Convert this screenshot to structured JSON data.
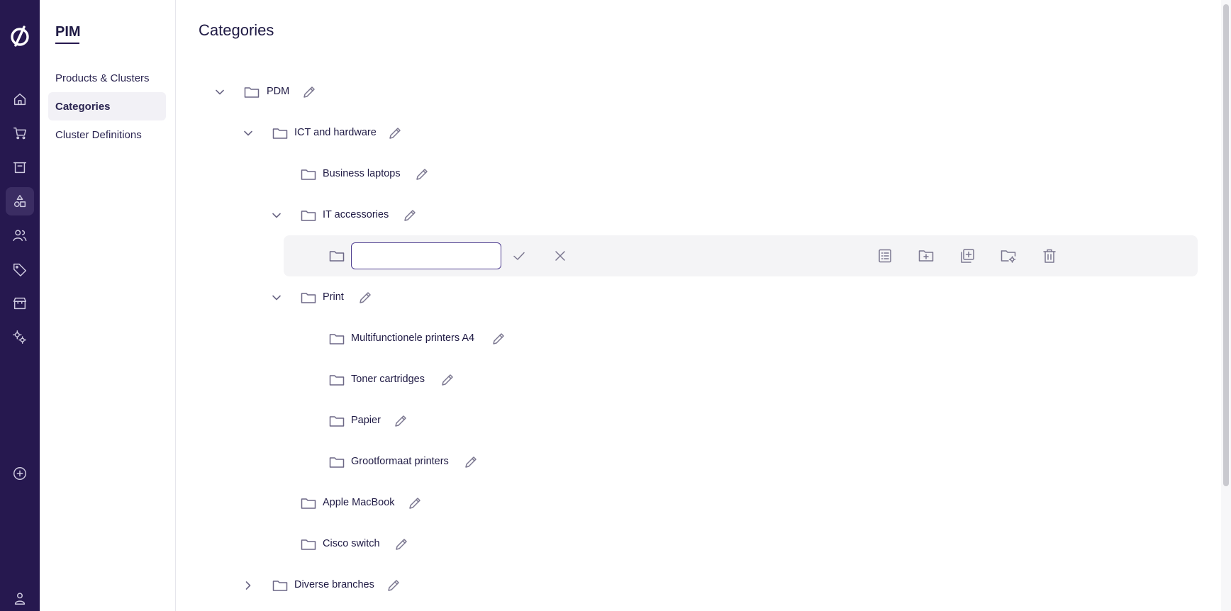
{
  "module": "PIM",
  "nav": {
    "items": [
      {
        "label": "Products & Clusters",
        "active": false
      },
      {
        "label": "Categories",
        "active": true
      },
      {
        "label": "Cluster Definitions",
        "active": false
      }
    ]
  },
  "page": {
    "title": "Categories"
  },
  "tree": {
    "pdm": "PDM",
    "ict": "ICT and hardware",
    "business_laptops": "Business laptops",
    "it_accessories": "IT accessories",
    "print": "Print",
    "mfp_a4": "Multifunctionele printers A4",
    "toner": "Toner cartridges",
    "papier": "Papier",
    "grootformaat": "Grootformaat printers",
    "apple": "Apple MacBook",
    "cisco": "Cisco switch",
    "diverse": "Diverse branches"
  },
  "edit": {
    "value": "",
    "placeholder": ""
  },
  "colors": {
    "rail": "#26184f",
    "accent": "#4d3c8f"
  }
}
